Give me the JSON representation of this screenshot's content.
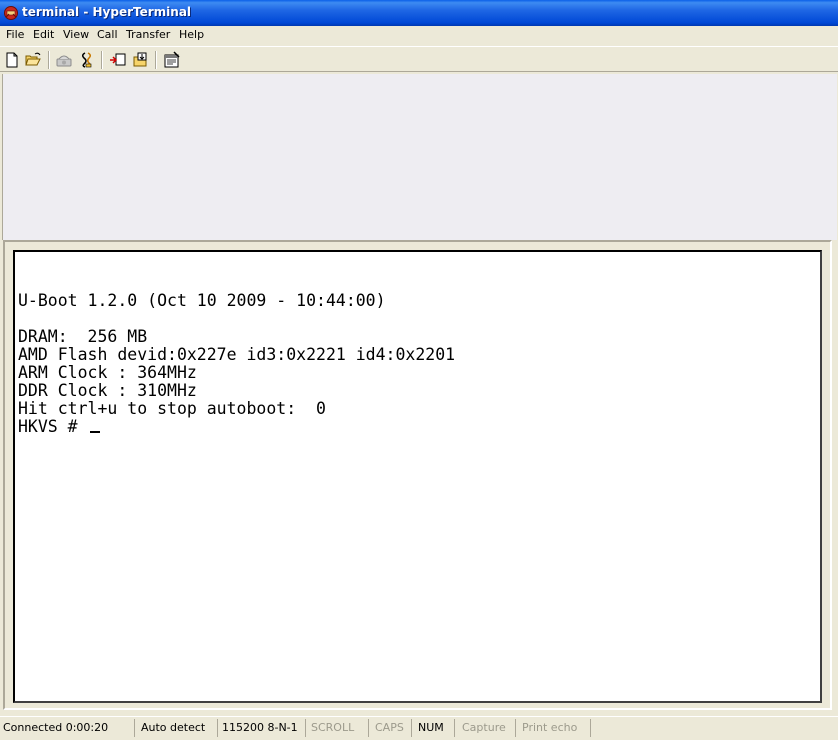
{
  "window": {
    "title": "terminal - HyperTerminal",
    "app_icon": "hyperterminal-icon"
  },
  "menu": {
    "items": [
      "File",
      "Edit",
      "View",
      "Call",
      "Transfer",
      "Help"
    ]
  },
  "toolbar": {
    "buttons": [
      {
        "name": "new-connection-icon"
      },
      {
        "name": "open-icon"
      },
      {
        "name": "call-icon"
      },
      {
        "name": "disconnect-icon"
      },
      {
        "name": "send-icon"
      },
      {
        "name": "receive-icon"
      },
      {
        "name": "properties-icon"
      }
    ]
  },
  "terminal": {
    "lines": [
      "U-Boot 1.2.0 (Oct 10 2009 - 10:44:00)",
      "",
      "DRAM:  256 MB",
      "AMD Flash devid:0x227e id3:0x2221 id4:0x2201",
      "ARM Clock : 364MHz",
      "DDR Clock : 310MHz",
      "Hit ctrl+u to stop autoboot:  0",
      "HKVS # "
    ]
  },
  "status": {
    "connected": "Connected 0:00:20",
    "detect": "Auto detect",
    "settings": "115200 8-N-1",
    "scroll": "SCROLL",
    "caps": "CAPS",
    "num": "NUM",
    "capture": "Capture",
    "print_echo": "Print echo"
  },
  "colors": {
    "titlebar": "#0054E3",
    "chrome": "#ECE9D8",
    "terminal_bg": "#FFFFFF",
    "terminal_text": "#000000",
    "status_dim": "#9C9A8C"
  }
}
